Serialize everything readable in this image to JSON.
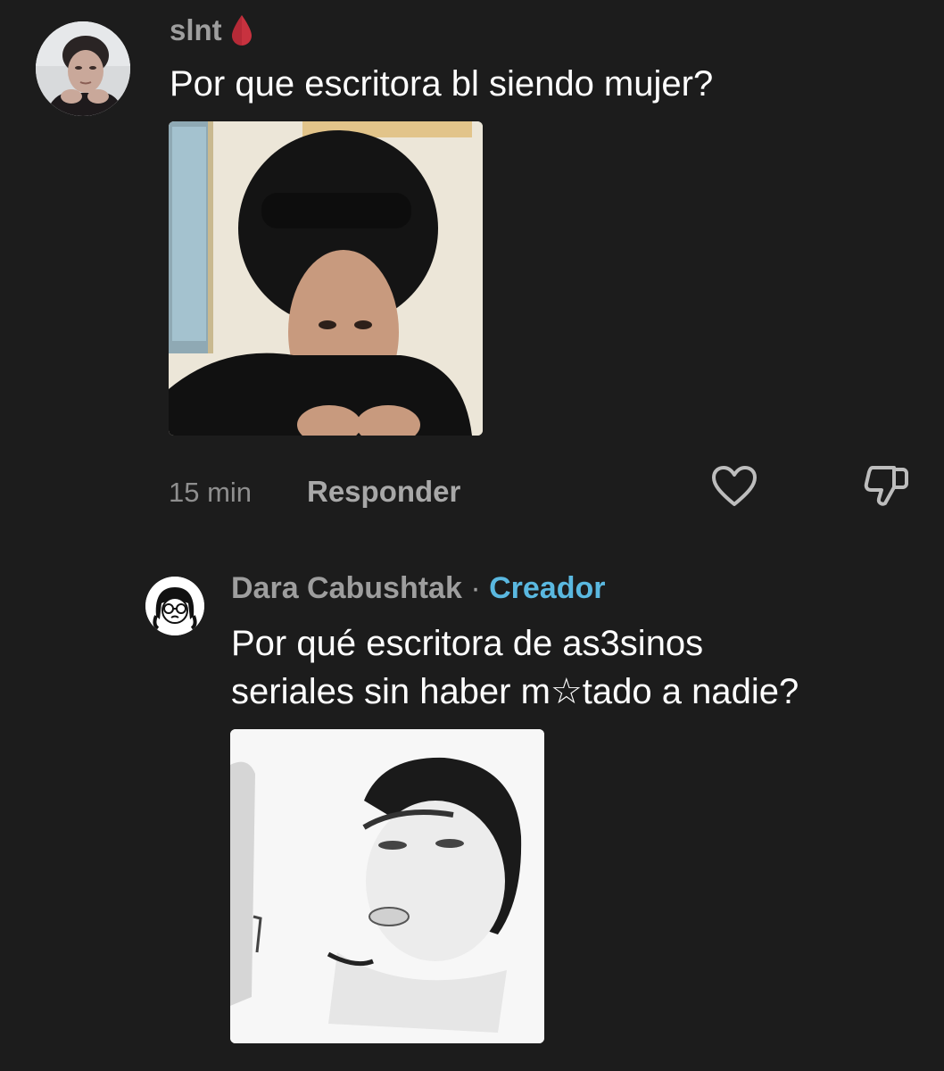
{
  "comment": {
    "username": "slnt",
    "text": "Por que escritora bl siendo mujer?",
    "timestamp": "15 min",
    "reply_label": "Responder",
    "avatar_icon": "user-avatar-photo",
    "image_icon": "reaction-photo",
    "drop_color": "#d1364a"
  },
  "reply": {
    "author": "Dara Cabushtak",
    "separator": " · ",
    "badge": "Creador",
    "text_line1": "Por qué escritora de as3sinos",
    "text_line2": "seriales sin haber m☆tado a nadie?",
    "avatar_icon": "cartoon-girl-avatar",
    "image_icon": "reaction-photo-bw"
  },
  "colors": {
    "background": "#1c1c1c",
    "badge": "#5ab8e0",
    "muted_text": "#9e9e9e"
  },
  "icons": {
    "like": "heart-outline-icon",
    "dislike": "thumbs-down-outline-icon",
    "username_badge": "blood-drop-icon"
  }
}
